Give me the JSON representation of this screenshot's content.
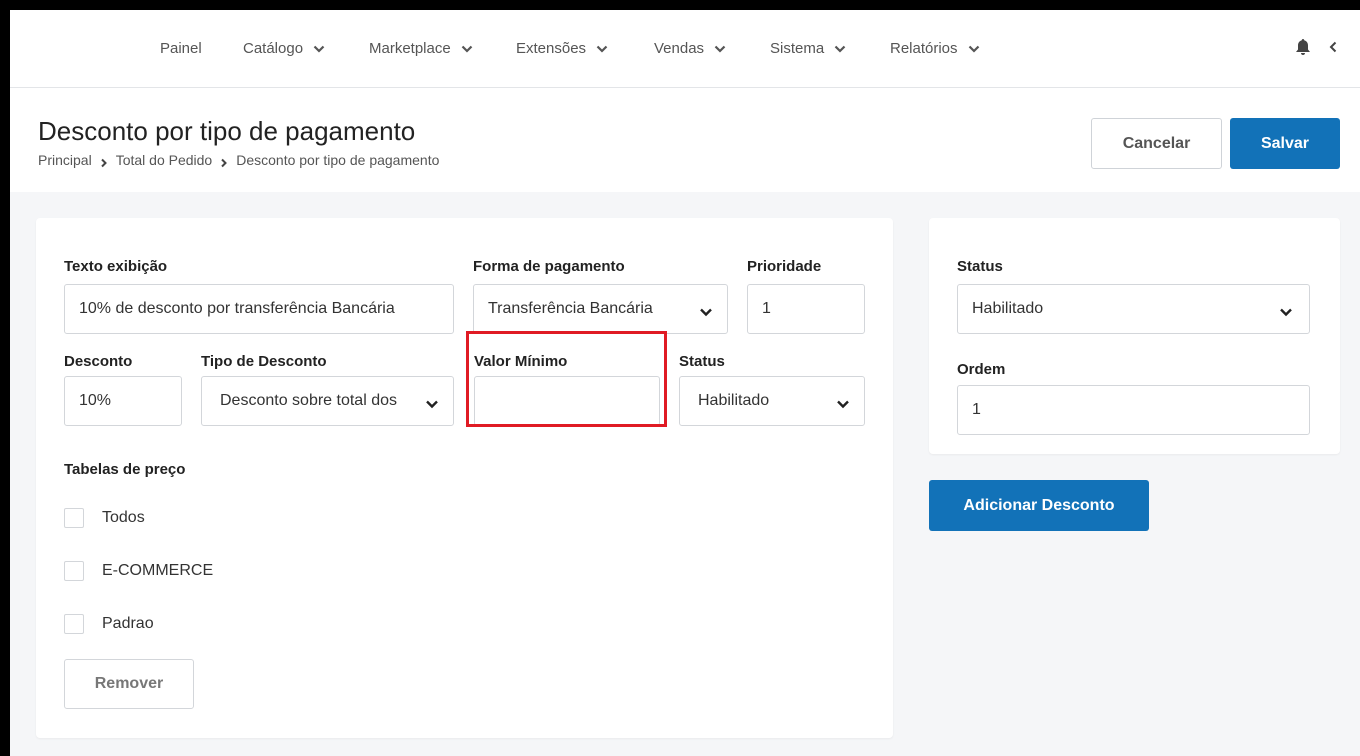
{
  "nav": {
    "items": [
      {
        "label": "Painel",
        "dropdown": false
      },
      {
        "label": "Catálogo",
        "dropdown": true
      },
      {
        "label": "Marketplace",
        "dropdown": true
      },
      {
        "label": "Extensões",
        "dropdown": true
      },
      {
        "label": "Vendas",
        "dropdown": true
      },
      {
        "label": "Sistema",
        "dropdown": true
      },
      {
        "label": "Relatórios",
        "dropdown": true
      }
    ],
    "icons": [
      "bell-icon",
      "chevron-left-icon"
    ]
  },
  "header": {
    "title": "Desconto por tipo de pagamento",
    "breadcrumb": [
      "Principal",
      "Total do Pedido",
      "Desconto por tipo de pagamento"
    ],
    "cancel_label": "Cancelar",
    "save_label": "Salvar"
  },
  "form": {
    "texto_label": "Texto exibição",
    "texto_value": "10% de desconto por transferência Bancária",
    "forma_label": "Forma de pagamento",
    "forma_value": "Transferência Bancária",
    "prioridade_label": "Prioridade",
    "prioridade_value": "1",
    "desconto_label": "Desconto",
    "desconto_value": "10%",
    "tipo_label": "Tipo de Desconto",
    "tipo_value": "Desconto sobre total dos",
    "valor_minimo_label": "Valor Mínimo",
    "valor_minimo_value": "",
    "status_label": "Status",
    "status_value": "Habilitado",
    "tabelas_label": "Tabelas de preço",
    "tabelas": [
      {
        "label": "Todos",
        "checked": false
      },
      {
        "label": "E-COMMERCE",
        "checked": false
      },
      {
        "label": "Padrao",
        "checked": false
      }
    ],
    "remove_label": "Remover"
  },
  "side": {
    "status_label": "Status",
    "status_value": "Habilitado",
    "ordem_label": "Ordem",
    "ordem_value": "1",
    "add_label": "Adicionar Desconto"
  },
  "colors": {
    "primary": "#1272b8",
    "highlight": "#e01b24"
  }
}
